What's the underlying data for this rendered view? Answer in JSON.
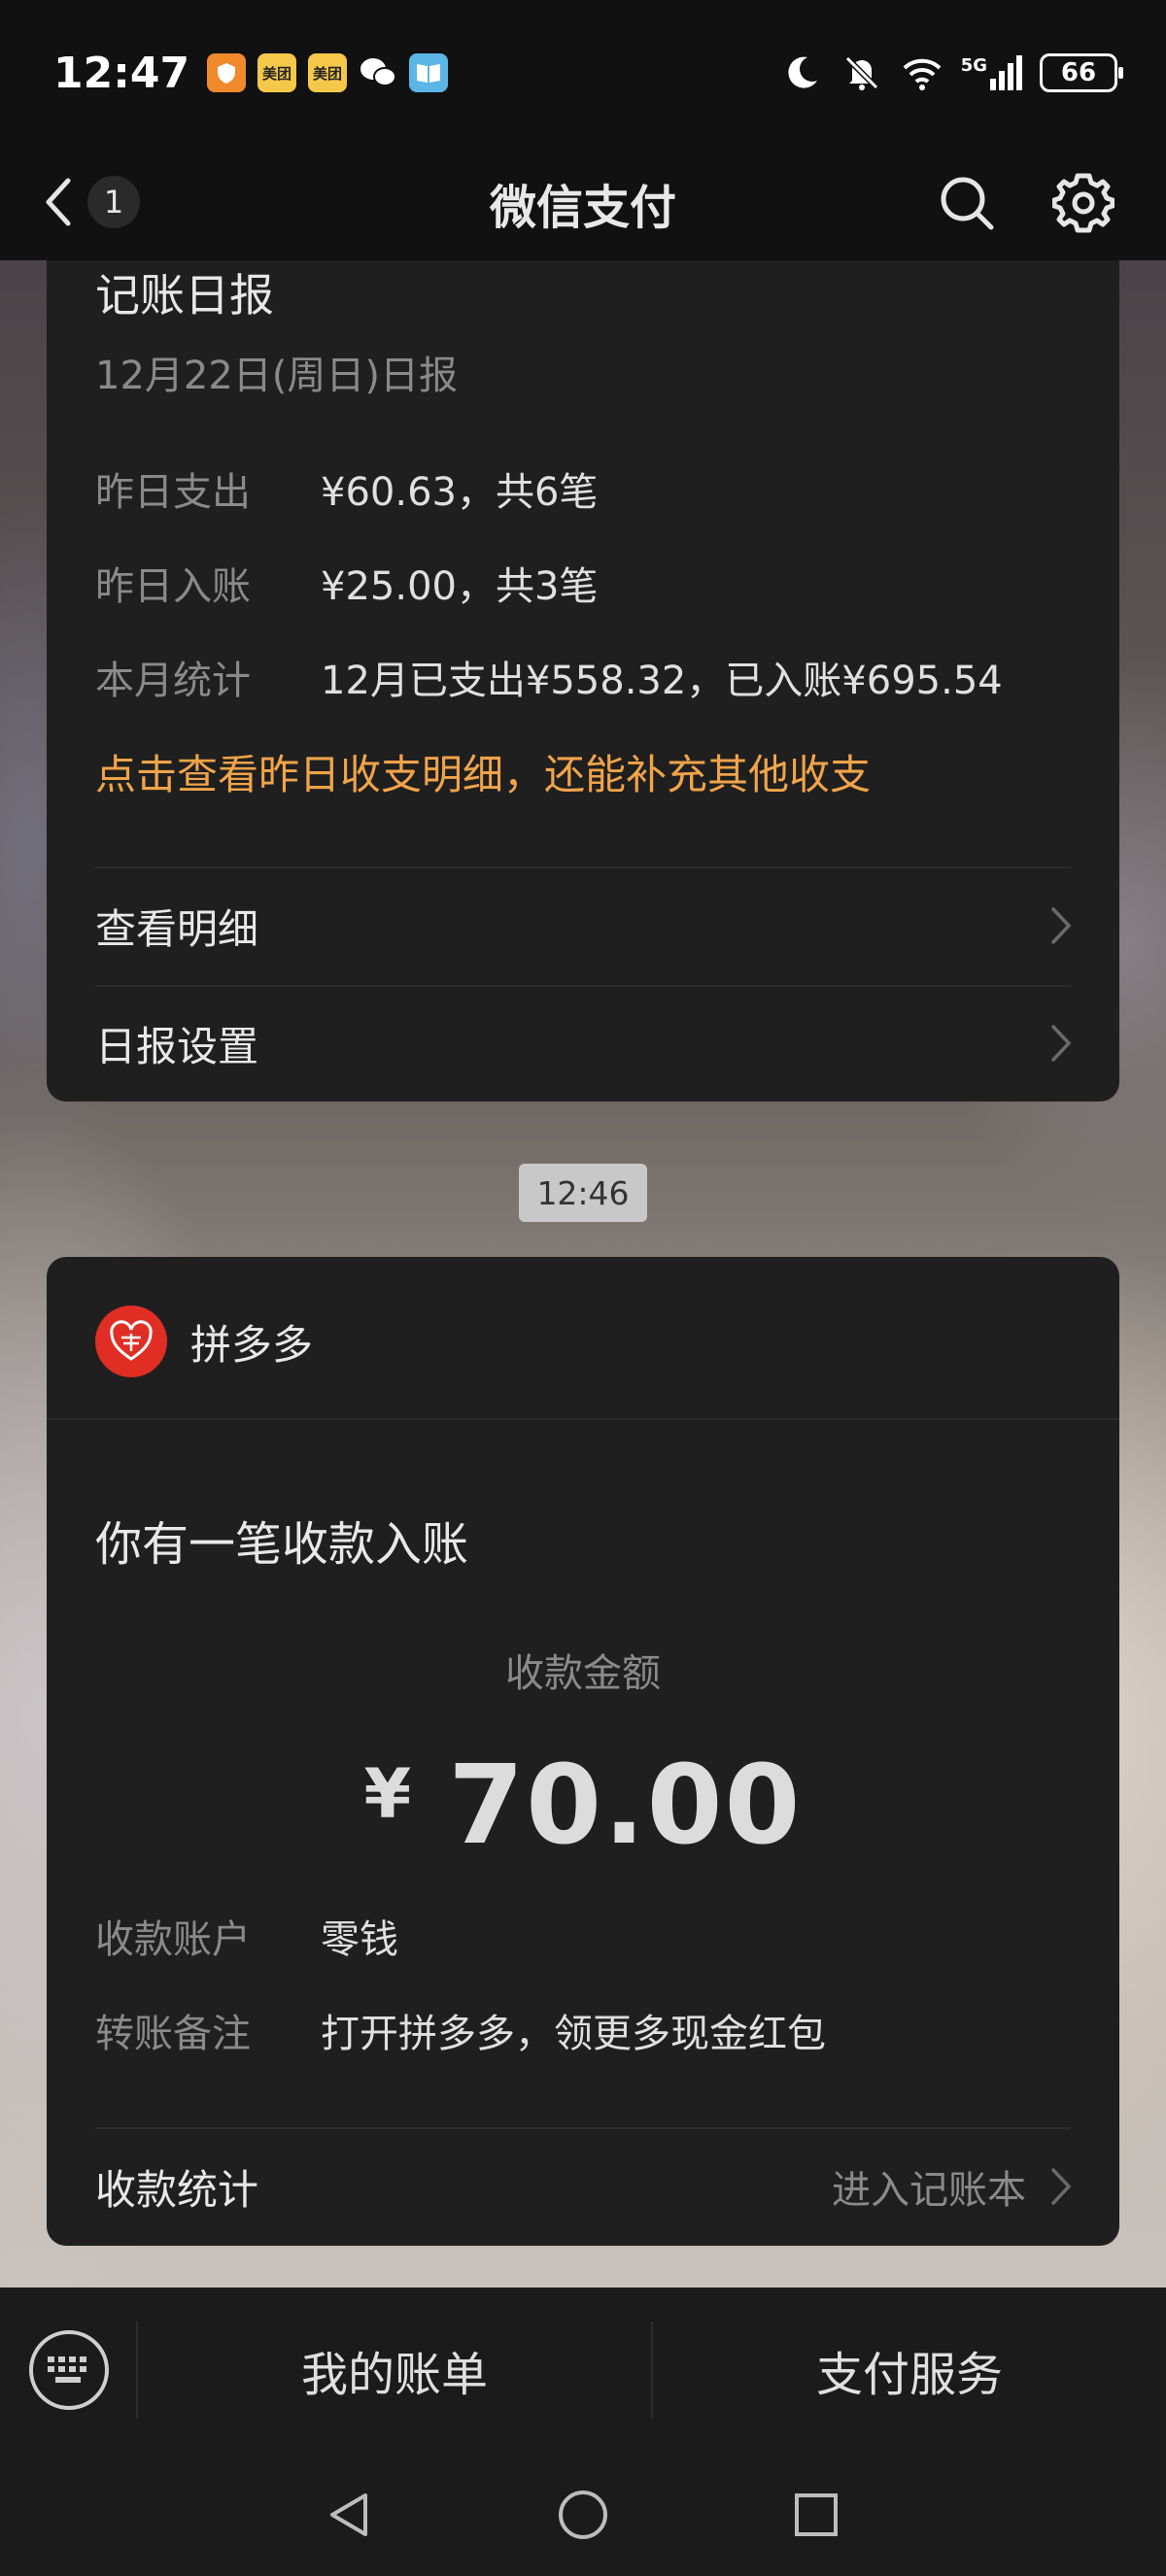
{
  "status_bar": {
    "time": "12:47",
    "battery": "66",
    "network": "5G",
    "app_badges": [
      {
        "name": "shield-app-icon",
        "color": "#f08a2c"
      },
      {
        "name": "meituan-icon",
        "text": "美团",
        "color": "#f5c84a"
      },
      {
        "name": "meituan-icon",
        "text": "美团",
        "color": "#f5c84a"
      },
      {
        "name": "wechat-icon",
        "color": "#ffffff"
      },
      {
        "name": "book-app-icon",
        "color": "#5bb6e6"
      }
    ]
  },
  "header": {
    "title": "微信支付",
    "unread_count": "1"
  },
  "daily_report": {
    "title": "记账日报",
    "subtitle": "12月22日(周日)日报",
    "rows": [
      {
        "label": "昨日支出",
        "value": "¥60.63，共6笔"
      },
      {
        "label": "昨日入账",
        "value": "¥25.00，共3笔"
      },
      {
        "label": "本月统计",
        "value": "12月已支出¥558.32，已入账¥695.54"
      }
    ],
    "link": "点击查看昨日收支明细，还能补充其他收支",
    "menu": [
      {
        "label": "查看明细"
      },
      {
        "label": "日报设置"
      }
    ]
  },
  "timestamp": "12:46",
  "payment_card": {
    "merchant": "拼多多",
    "headline": "你有一笔收款入账",
    "amount_label": "收款金额",
    "currency": "¥",
    "amount": "70.00",
    "rows": [
      {
        "label": "收款账户",
        "value": "零钱"
      },
      {
        "label": "转账备注",
        "value": "打开拼多多，领更多现金红包"
      }
    ],
    "footer_label": "收款统计",
    "footer_action": "进入记账本",
    "logo_color": "#e02e24"
  },
  "bottom_bar": {
    "items": [
      "我的账单",
      "支付服务"
    ]
  },
  "colors": {
    "accent_orange": "#f0a44a",
    "card_bg": "#1f1f1f",
    "page_bg": "#111111"
  }
}
